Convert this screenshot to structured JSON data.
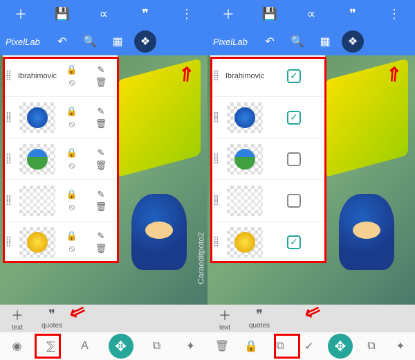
{
  "app": {
    "brand": "PixelLab"
  },
  "toolbar": {
    "text": "text",
    "quotes": "quotes"
  },
  "panel": {
    "rows": [
      {
        "textLabel": "Ibrahimovic"
      },
      {
        "thumb": "blue"
      },
      {
        "thumb": "green"
      },
      {
        "thumb": "white"
      },
      {
        "thumb": "yellow"
      }
    ]
  },
  "right": {
    "checks": [
      true,
      true,
      false,
      false,
      true
    ]
  },
  "watermark": "Caraeditpoto2"
}
